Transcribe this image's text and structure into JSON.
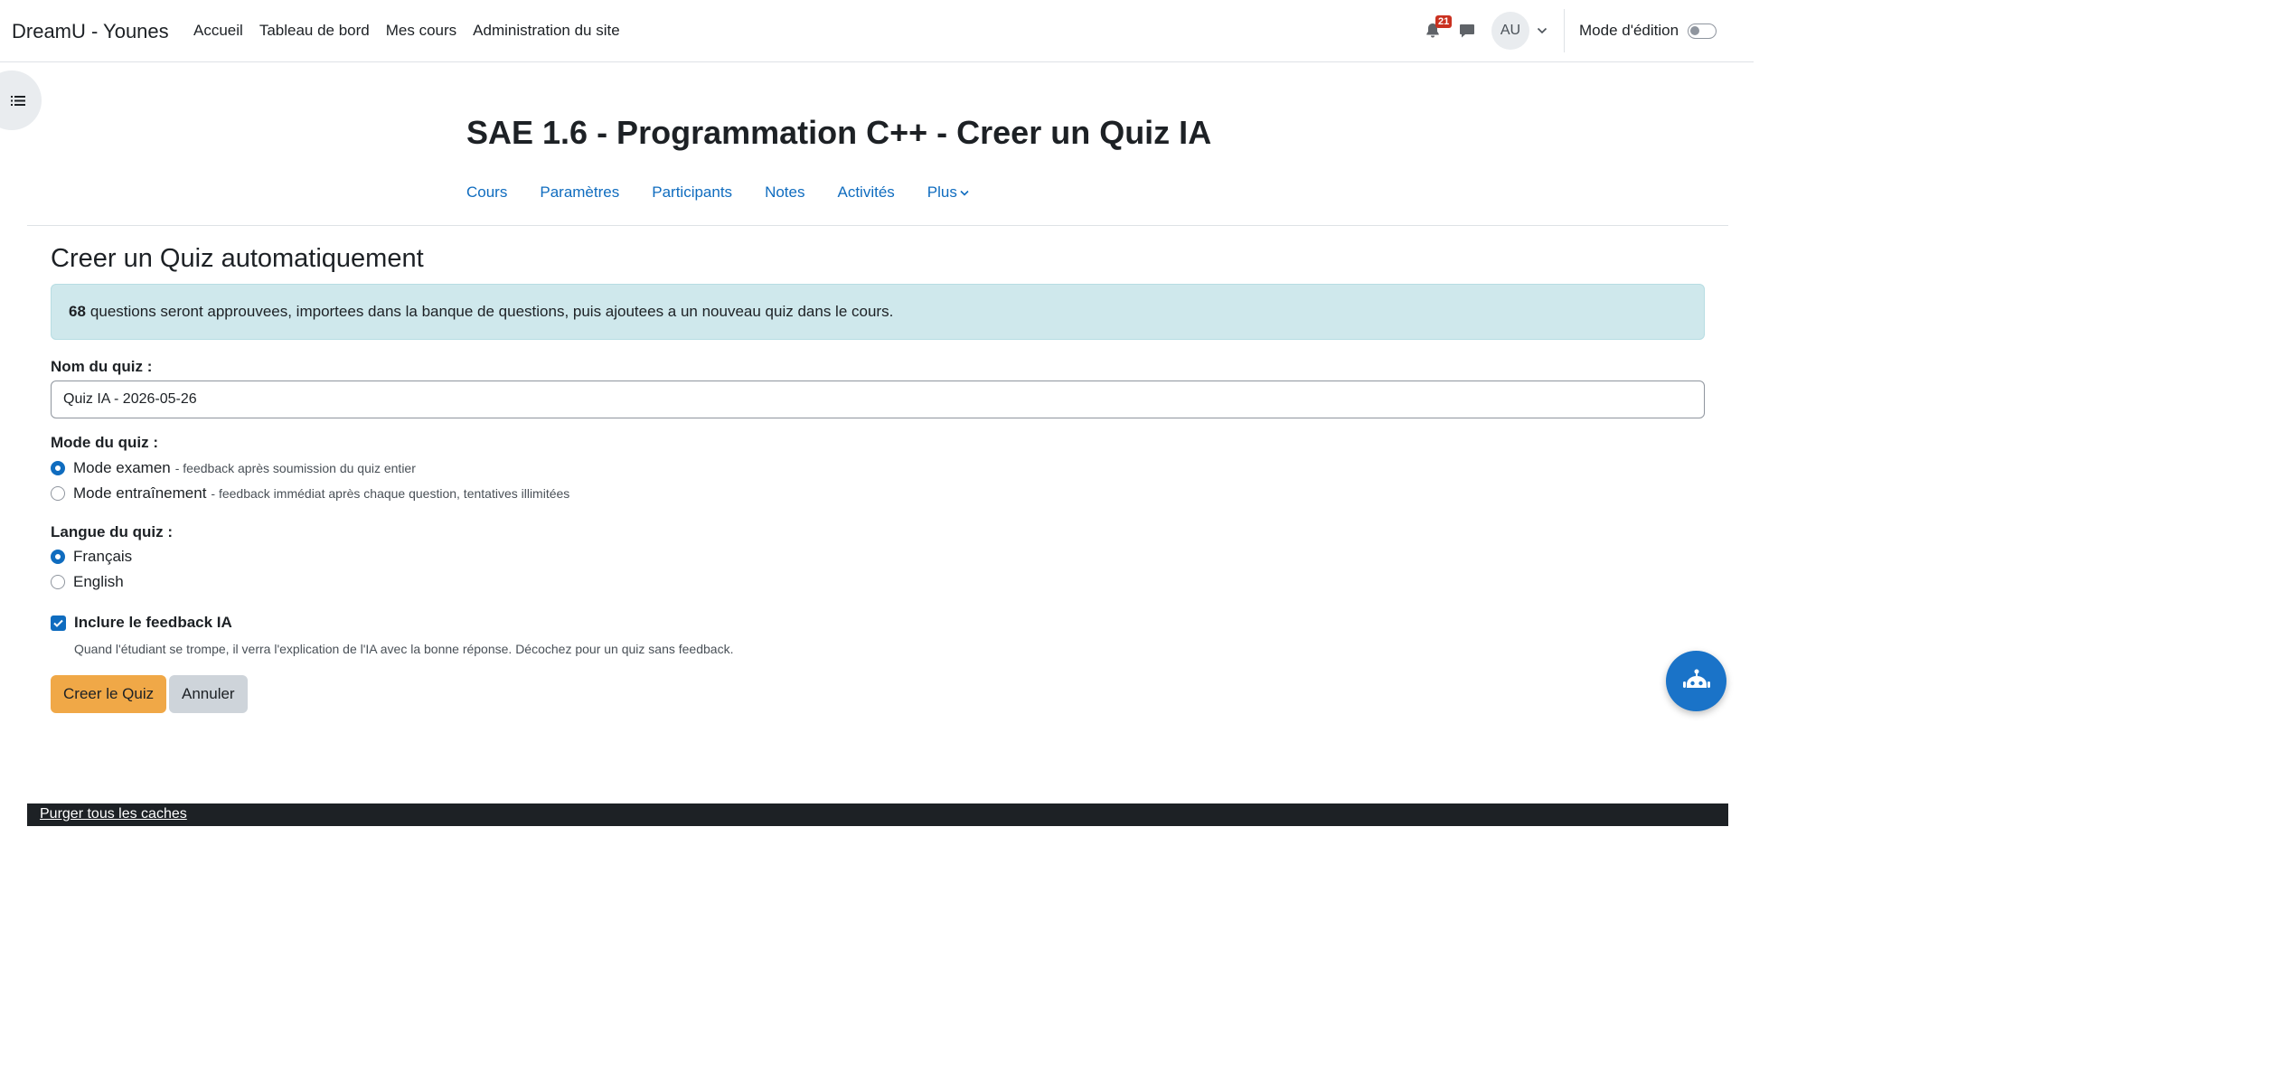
{
  "navbar": {
    "brand": "DreamU - Younes",
    "links": [
      "Accueil",
      "Tableau de bord",
      "Mes cours",
      "Administration du site"
    ],
    "notification_count": "21",
    "avatar_initials": "AU",
    "edit_mode_label": "Mode d'édition",
    "edit_mode_on": false
  },
  "course": {
    "title": "SAE 1.6 - Programmation C++ - Creer un Quiz IA",
    "tabs": [
      "Cours",
      "Paramètres",
      "Participants",
      "Notes",
      "Activités",
      "Plus"
    ]
  },
  "form": {
    "heading": "Creer un Quiz automatiquement",
    "alert_count": "68",
    "alert_text": "questions seront approuvees, importees dans la banque de questions, puis ajoutees a un nouveau quiz dans le cours.",
    "name_label": "Nom du quiz :",
    "name_value": "Quiz IA - 2026-05-26",
    "mode_label": "Mode du quiz :",
    "modes": [
      {
        "label": "Mode examen",
        "desc": "- feedback après soumission du quiz entier",
        "selected": true
      },
      {
        "label": "Mode entraînement",
        "desc": "- feedback immédiat après chaque question, tentatives illimitées",
        "selected": false
      }
    ],
    "lang_label": "Langue du quiz :",
    "languages": [
      {
        "label": "Français",
        "selected": true
      },
      {
        "label": "English",
        "selected": false
      }
    ],
    "feedback_label": "Inclure le feedback IA",
    "feedback_checked": true,
    "feedback_help": "Quand l'étudiant se trompe, il verra l'explication de l'IA avec la bonne réponse. Décochez pour un quiz sans feedback.",
    "submit_label": "Creer le Quiz",
    "cancel_label": "Annuler"
  },
  "footer": {
    "purge_link": "Purger tous les caches"
  },
  "colors": {
    "link": "#0f6cbf",
    "primary_button": "#f0a847",
    "alert_bg": "#cfe8ec",
    "fab": "#1a73c8",
    "footer_bg": "#1d2125"
  }
}
